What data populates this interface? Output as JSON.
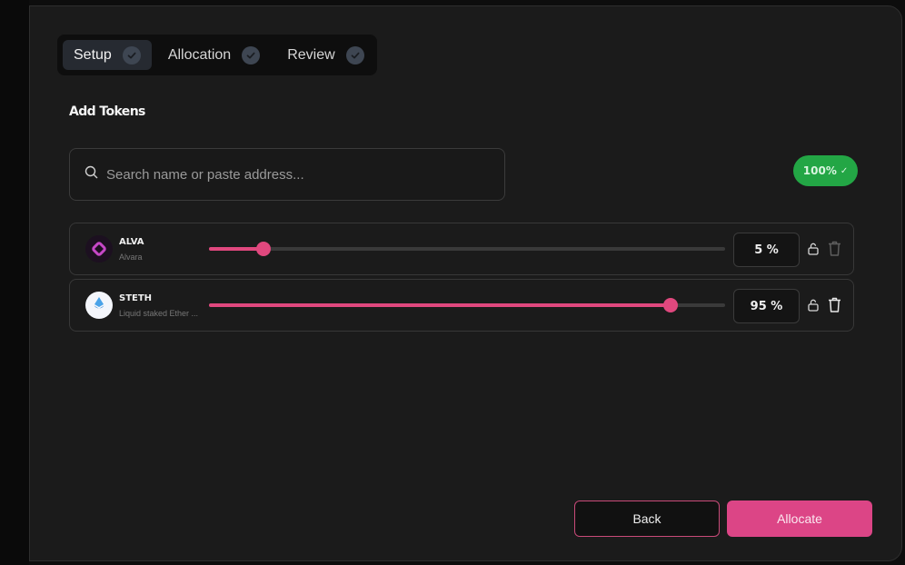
{
  "stepper": {
    "steps": [
      {
        "label": "Setup",
        "active": true
      },
      {
        "label": "Allocation",
        "active": false
      },
      {
        "label": "Review",
        "active": false
      }
    ]
  },
  "add_tokens": {
    "title": "Add Tokens"
  },
  "search": {
    "placeholder": "Search name or paste address..."
  },
  "total_badge": {
    "label": "100%",
    "icon": "check-icon"
  },
  "tokens": [
    {
      "symbol": "ALVA",
      "name": "Alvara",
      "percent_label": "5 %",
      "allocation": 0.05,
      "logo_icon": "alvara-logo-icon"
    },
    {
      "symbol": "STETH",
      "name": "Liquid staked Ether ...",
      "percent_label": "95 %",
      "allocation": 0.95,
      "logo_icon": "lido-logo-icon"
    }
  ],
  "footer": {
    "back_label": "Back",
    "allocate_label": "Allocate"
  },
  "colors": {
    "accent": "#e0487e",
    "success": "#23a645",
    "background": "#1b1b1b"
  }
}
